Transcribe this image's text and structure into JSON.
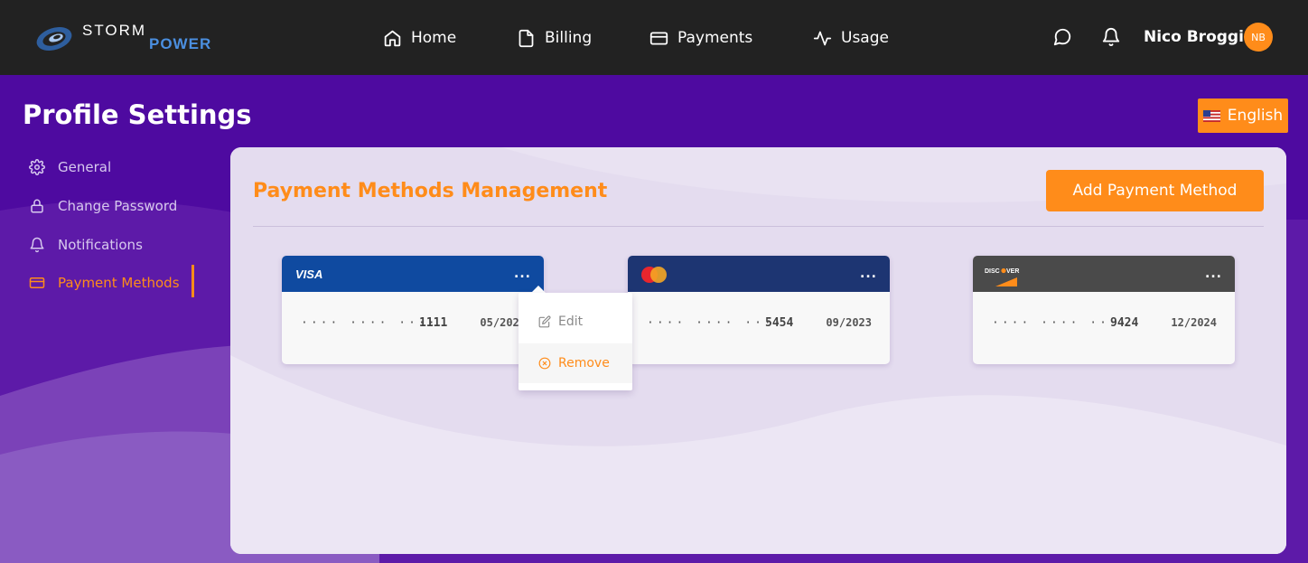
{
  "brand": {
    "logo_word1": "STORM",
    "logo_word2": "POWER"
  },
  "nav": {
    "items": [
      {
        "label": "Home",
        "icon": "home-icon"
      },
      {
        "label": "Billing",
        "icon": "file-icon"
      },
      {
        "label": "Payments",
        "icon": "credit-card-icon"
      },
      {
        "label": "Usage",
        "icon": "activity-icon"
      }
    ]
  },
  "user": {
    "name": "Nico Broggi",
    "initials": "NB"
  },
  "page": {
    "title": "Profile Settings"
  },
  "language": {
    "label": "English",
    "flag": "us-flag-icon"
  },
  "sidebar": {
    "items": [
      {
        "label": "General",
        "icon": "gear-icon"
      },
      {
        "label": "Change Password",
        "icon": "lock-icon"
      },
      {
        "label": "Notifications",
        "icon": "bell-icon"
      },
      {
        "label": "Payment Methods",
        "icon": "credit-card-icon",
        "active": true
      }
    ]
  },
  "panel": {
    "title": "Payment Methods Management",
    "add_button": "Add Payment Method"
  },
  "cards": [
    {
      "brand": "VISA",
      "mask": "···· ···· ····",
      "last4": "1111",
      "expiry": "05/2022",
      "menu": "...",
      "header_color": "#0f4aa0"
    },
    {
      "brand": "MasterCard",
      "mask": "···· ···· ····",
      "last4": "5454",
      "expiry": "09/2023",
      "menu": "...",
      "header_color": "#1d3572"
    },
    {
      "brand": "DISCOVER",
      "mask": "···· ···· ····",
      "last4": "9424",
      "expiry": "12/2024",
      "menu": "...",
      "header_color": "#4a4a4a"
    }
  ],
  "card_menu": {
    "edit": "Edit",
    "remove": "Remove"
  },
  "colors": {
    "accent": "#ff8c1a",
    "topbar": "#222222",
    "background": "#4e0aa0"
  }
}
